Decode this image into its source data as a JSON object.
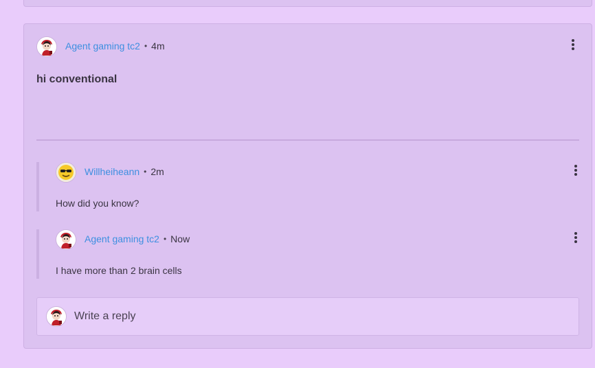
{
  "post": {
    "author": "Agent gaming tc2",
    "separator": "•",
    "time": "4m",
    "title": "hi conventional",
    "avatar_icon": "anime-avatar-icon",
    "menu_icon": "more-vertical-icon"
  },
  "replies": [
    {
      "author": "Willheiheann",
      "separator": "•",
      "time": "2m",
      "text": "How did you know?",
      "avatar_icon": "sunglasses-emoji-avatar-icon"
    },
    {
      "author": "Agent gaming tc2",
      "separator": "•",
      "time": "Now",
      "text": "I have more than 2 brain cells",
      "avatar_icon": "anime-avatar-icon"
    }
  ],
  "reply_box": {
    "placeholder": "Write a reply"
  },
  "colors": {
    "background": "#e9ccfb",
    "card": "#dcc2f1",
    "author_link": "#3d8fe0"
  }
}
